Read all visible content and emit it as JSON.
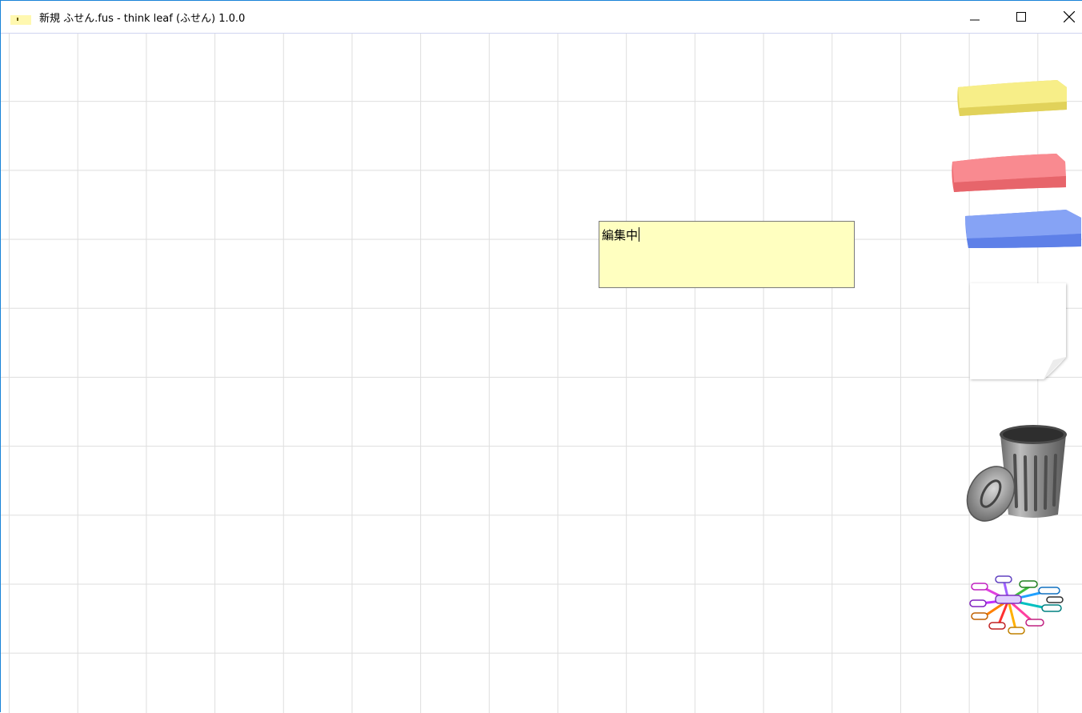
{
  "window": {
    "title": "新規 ふせん.fus - think leaf (ふせん) 1.0.0",
    "icon": "sticky-note-icon",
    "controls": [
      "minimize-icon",
      "maximize-icon",
      "close-icon"
    ]
  },
  "sticky_note": {
    "text": "編集中",
    "color": "#ffffc0",
    "state": "editing"
  },
  "toolbox": [
    {
      "name": "yellow-sticky-pad",
      "color": "#f5e97a"
    },
    {
      "name": "red-sticky-pad",
      "color": "#f27a80"
    },
    {
      "name": "blue-sticky-pad",
      "color": "#7595f2"
    },
    {
      "name": "blank-page",
      "color": "#ffffff"
    },
    {
      "name": "trash-can",
      "color": "#888888"
    },
    {
      "name": "mind-map",
      "color": "#c040c0"
    }
  ]
}
